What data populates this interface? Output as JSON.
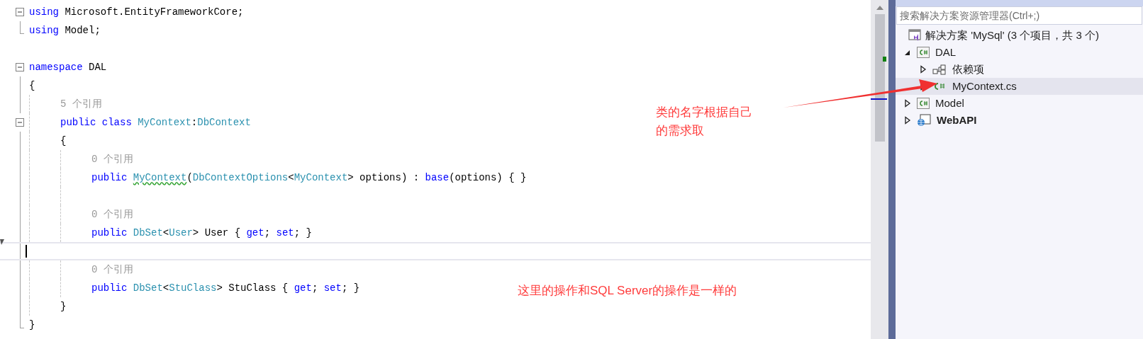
{
  "editor": {
    "blocks": [
      {
        "kind": "fold",
        "children": [
          {
            "kind": "code",
            "tokens": [
              {
                "text": "using",
                "kind": "keyword"
              },
              {
                "text": " Microsoft.EntityFrameworkCore;",
                "kind": "plain"
              }
            ]
          },
          {
            "kind": "code",
            "tokens": [
              {
                "text": "using",
                "kind": "keyword"
              },
              {
                "text": " Model;",
                "kind": "plain"
              }
            ]
          }
        ]
      },
      {
        "kind": "blank"
      },
      {
        "kind": "fold",
        "children": [
          {
            "kind": "code",
            "tokens": [
              {
                "text": "namespace",
                "kind": "keyword"
              },
              {
                "text": " DAL",
                "kind": "plain"
              }
            ]
          },
          {
            "kind": "code",
            "tokens": [
              {
                "text": "{",
                "kind": "plain"
              }
            ]
          },
          {
            "kind": "group",
            "children": [
              {
                "kind": "lens",
                "text": "5 个引用"
              },
              {
                "kind": "fold",
                "children": [
                  {
                    "kind": "code",
                    "tokens": [
                      {
                        "text": "public class ",
                        "kind": "keyword"
                      },
                      {
                        "text": "MyContext",
                        "kind": "type"
                      },
                      {
                        "text": ":",
                        "kind": "plain"
                      },
                      {
                        "text": "DbContext",
                        "kind": "type"
                      }
                    ]
                  },
                  {
                    "kind": "code",
                    "tokens": [
                      {
                        "text": "{",
                        "kind": "plain"
                      }
                    ]
                  },
                  {
                    "kind": "group",
                    "children": [
                      {
                        "kind": "lens",
                        "text": "0 个引用"
                      },
                      {
                        "kind": "code",
                        "tokens": [
                          {
                            "text": "public ",
                            "kind": "keyword"
                          },
                          {
                            "text": "MyContext",
                            "kind": "type",
                            "squiggle": true
                          },
                          {
                            "text": "(",
                            "kind": "plain"
                          },
                          {
                            "text": "DbContextOptions",
                            "kind": "type"
                          },
                          {
                            "text": "<",
                            "kind": "plain"
                          },
                          {
                            "text": "MyContext",
                            "kind": "type"
                          },
                          {
                            "text": "> options) : ",
                            "kind": "plain"
                          },
                          {
                            "text": "base",
                            "kind": "keyword"
                          },
                          {
                            "text": "(options) { }",
                            "kind": "plain"
                          }
                        ]
                      },
                      {
                        "kind": "blank"
                      },
                      {
                        "kind": "lens",
                        "text": "0 个引用"
                      },
                      {
                        "kind": "code",
                        "tokens": [
                          {
                            "text": "public ",
                            "kind": "keyword"
                          },
                          {
                            "text": "DbSet",
                            "kind": "type"
                          },
                          {
                            "text": "<",
                            "kind": "plain"
                          },
                          {
                            "text": "User",
                            "kind": "type"
                          },
                          {
                            "text": "> User { ",
                            "kind": "plain"
                          },
                          {
                            "text": "get",
                            "kind": "keyword"
                          },
                          {
                            "text": "; ",
                            "kind": "plain"
                          },
                          {
                            "text": "set",
                            "kind": "keyword"
                          },
                          {
                            "text": "; }",
                            "kind": "plain"
                          }
                        ]
                      },
                      {
                        "kind": "caret"
                      },
                      {
                        "kind": "lens",
                        "text": "0 个引用"
                      },
                      {
                        "kind": "code",
                        "tokens": [
                          {
                            "text": "public ",
                            "kind": "keyword"
                          },
                          {
                            "text": "DbSet",
                            "kind": "type"
                          },
                          {
                            "text": "<",
                            "kind": "plain"
                          },
                          {
                            "text": "StuClass",
                            "kind": "type"
                          },
                          {
                            "text": "> StuClass { ",
                            "kind": "plain"
                          },
                          {
                            "text": "get",
                            "kind": "keyword"
                          },
                          {
                            "text": "; ",
                            "kind": "plain"
                          },
                          {
                            "text": "set",
                            "kind": "keyword"
                          },
                          {
                            "text": "; }",
                            "kind": "plain"
                          }
                        ]
                      }
                    ]
                  },
                  {
                    "kind": "code",
                    "tokens": [
                      {
                        "text": "}",
                        "kind": "plain"
                      }
                    ]
                  }
                ]
              }
            ]
          },
          {
            "kind": "code",
            "tokens": [
              {
                "text": "}",
                "kind": "plain"
              }
            ]
          }
        ]
      }
    ]
  },
  "solution_explorer": {
    "search": {
      "placeholder": "搜索解决方案资源管理器(Ctrl+;)"
    },
    "solution": {
      "label": "解决方案 'MySql' (3 个项目，共 3 个)",
      "children": [
        {
          "label": "DAL",
          "kind": "project",
          "expanded": true,
          "bold": false,
          "selected": false,
          "children": [
            {
              "label": "依赖项",
              "kind": "dependencies",
              "expanded": false,
              "bold": false,
              "selected": false
            },
            {
              "label": "MyContext.cs",
              "kind": "file",
              "expanded": false,
              "bold": false,
              "selected": true
            }
          ]
        },
        {
          "label": "Model",
          "kind": "project",
          "expanded": false,
          "bold": false,
          "selected": false
        },
        {
          "label": "WebAPI",
          "kind": "web",
          "expanded": false,
          "bold": true,
          "selected": false
        }
      ]
    }
  },
  "annotations": [
    {
      "text": "类的名字根据自己的需求取",
      "kind": "callout"
    },
    {
      "text": "这里的操作和SQL Server的操作是一样的",
      "kind": "note"
    }
  ]
}
